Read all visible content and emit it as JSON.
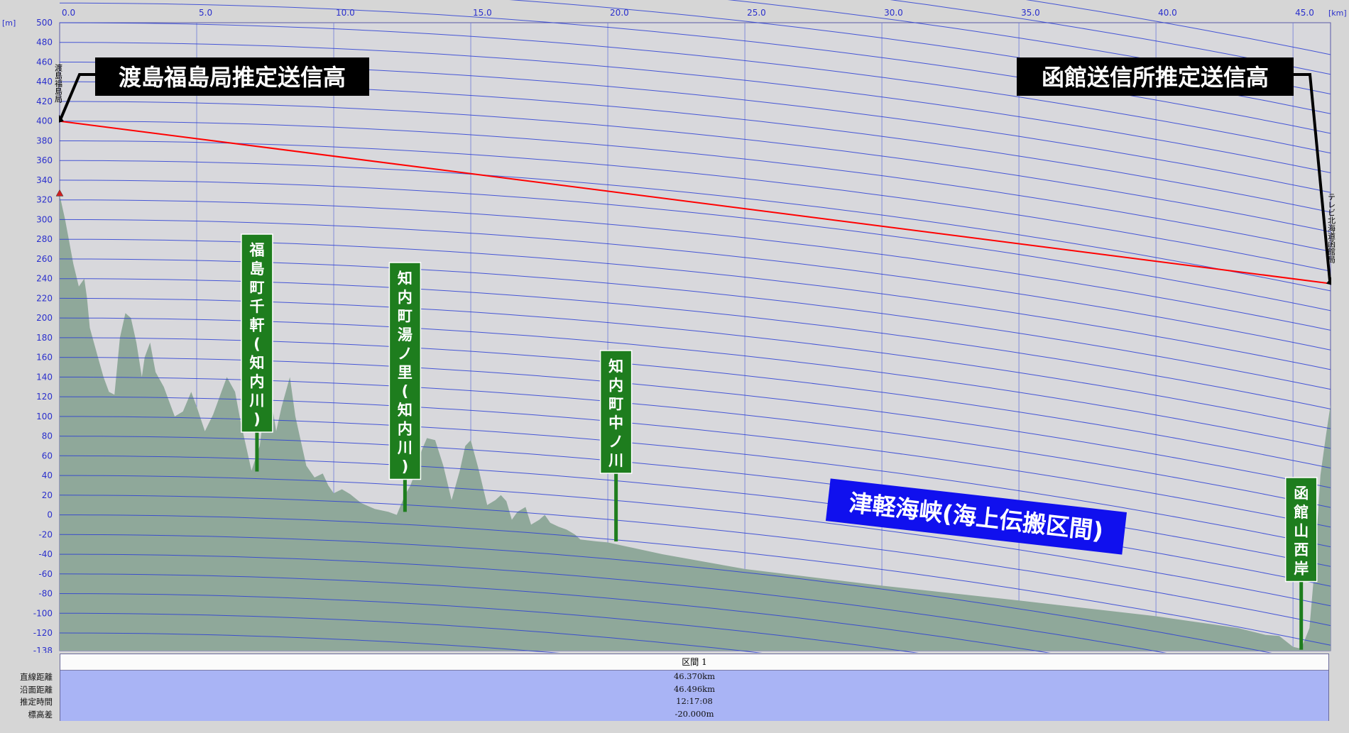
{
  "chart_data": {
    "type": "area",
    "x_unit": "[km]",
    "y_unit": "[m]",
    "x_ticks": [
      "0.0",
      "5.0",
      "10.0",
      "15.0",
      "20.0",
      "25.0",
      "30.0",
      "35.0",
      "40.0",
      "45.0"
    ],
    "x_tick_values": [
      0,
      5,
      10,
      15,
      20,
      25,
      30,
      35,
      40,
      45
    ],
    "y_ticks": [
      "500",
      "480",
      "460",
      "440",
      "420",
      "400",
      "380",
      "360",
      "340",
      "320",
      "300",
      "280",
      "260",
      "240",
      "220",
      "200",
      "180",
      "160",
      "140",
      "120",
      "100",
      "80",
      "60",
      "40",
      "20",
      "0",
      "-20",
      "-40",
      "-60",
      "-80",
      "-100",
      "-120",
      "-138"
    ],
    "y_tick_values": [
      500,
      480,
      460,
      440,
      420,
      400,
      380,
      360,
      340,
      320,
      300,
      280,
      260,
      240,
      220,
      200,
      180,
      160,
      140,
      120,
      100,
      80,
      60,
      40,
      20,
      0,
      -20,
      -40,
      -60,
      -80,
      -100,
      -120,
      -138
    ],
    "xlim": [
      0,
      46.37
    ],
    "ylim": [
      -138,
      500
    ],
    "grid": true,
    "terrain": {
      "x": [
        0,
        0.2,
        0.5,
        0.7,
        0.9,
        1.0,
        1.1,
        1.4,
        1.6,
        1.8,
        2.0,
        2.2,
        2.4,
        2.6,
        2.8,
        3.0,
        3.1,
        3.3,
        3.5,
        3.8,
        4.0,
        4.2,
        4.5,
        4.8,
        5.0,
        5.3,
        5.6,
        5.9,
        6.1,
        6.4,
        6.6,
        6.8,
        7.0,
        7.3,
        7.5,
        7.7,
        7.9,
        8.1,
        8.4,
        8.6,
        8.8,
        9.0,
        9.3,
        9.6,
        9.8,
        10.0,
        10.3,
        10.6,
        11.0,
        11.5,
        12.0,
        12.3,
        12.6,
        12.8,
        13.0,
        13.2,
        13.4,
        13.7,
        14.0,
        14.3,
        14.6,
        14.8,
        15.0,
        15.3,
        15.6,
        15.9,
        16.1,
        16.3,
        16.5,
        16.7,
        17.0,
        17.2,
        17.5,
        17.7,
        17.9,
        18.2,
        18.5,
        18.8,
        19.0,
        19.3,
        19.6,
        20.0,
        20.5,
        21.0,
        22.0,
        25.0,
        30.0,
        35.0,
        40.0,
        42.0,
        43.0,
        44.0,
        44.5,
        45.0,
        45.3,
        45.6,
        45.8,
        46.0,
        46.2,
        46.37
      ],
      "y": [
        325,
        300,
        255,
        232,
        240,
        220,
        190,
        160,
        140,
        125,
        122,
        180,
        205,
        200,
        175,
        140,
        160,
        175,
        145,
        130,
        115,
        100,
        105,
        125,
        110,
        85,
        102,
        125,
        140,
        125,
        95,
        70,
        45,
        70,
        115,
        120,
        85,
        110,
        140,
        100,
        75,
        50,
        38,
        42,
        30,
        22,
        26,
        21,
        12,
        6,
        3,
        0,
        20,
        30,
        45,
        65,
        78,
        76,
        50,
        15,
        45,
        70,
        76,
        45,
        10,
        15,
        20,
        14,
        -5,
        3,
        8,
        -10,
        -5,
        0,
        -8,
        -12,
        -15,
        -20,
        -25,
        -26,
        -27,
        -28,
        -31,
        -34,
        -40,
        -55,
        -72,
        -87,
        -103,
        -111,
        -115,
        -122,
        -123,
        -134,
        -136,
        -115,
        -50,
        40,
        80,
        112
      ],
      "color": "#8fa89a"
    },
    "signal_path": {
      "from": {
        "x": 0,
        "y": 400
      },
      "to": {
        "x": 46.37,
        "y": 235
      },
      "color": "#ff0000"
    },
    "start_marker": {
      "x": 0,
      "y": 326
    },
    "stations": [
      {
        "name": "渡島福島局",
        "x": 0
      },
      {
        "name": "テレビ北海道函館局",
        "x": 46.37
      }
    ],
    "callouts": [
      {
        "text": "渡島福島局推定送信高"
      },
      {
        "text": "函館送信所推定送信高"
      }
    ],
    "place_labels": [
      {
        "text": "福島町千軒(知内川)",
        "x": 7.2,
        "y": 44
      },
      {
        "text": "知内町湯ノ里(知内川)",
        "x": 12.6,
        "y": 3
      },
      {
        "text": "知内町中ノ川",
        "x": 20.3,
        "y": -27
      },
      {
        "text": "函館山西岸",
        "x": 45.3,
        "y": -137
      }
    ],
    "strait_label": {
      "text": "津軽海峡(海上伝搬区間)"
    },
    "curve_color": "#2c3ed4"
  },
  "info": {
    "header": "区間 1",
    "labels": [
      "直線距離",
      "沿面距離",
      "推定時間",
      "標高差"
    ],
    "values": [
      "46.370km",
      "46.496km",
      "12:17:08",
      "-20.000m"
    ]
  }
}
